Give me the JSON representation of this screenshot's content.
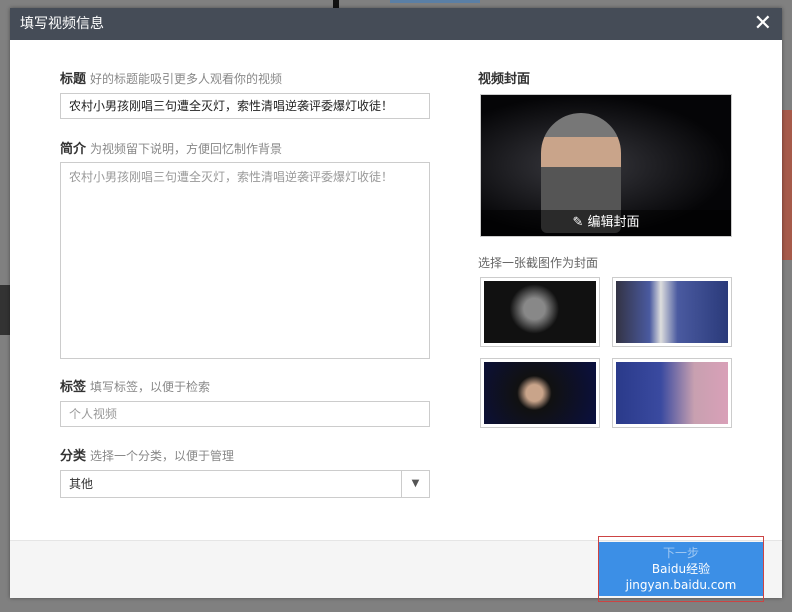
{
  "dialog": {
    "title": "填写视频信息"
  },
  "title_field": {
    "label": "标题",
    "hint": "好的标题能吸引更多人观看你的视频",
    "value": "农村小男孩刚唱三句遭全灭灯，索性清唱逆袭评委爆灯收徒！"
  },
  "intro_field": {
    "label": "简介",
    "hint": "为视频留下说明，方便回忆制作背景",
    "value": "农村小男孩刚唱三句遭全灭灯，索性清唱逆袭评委爆灯收徒！"
  },
  "tags_field": {
    "label": "标签",
    "hint": "填写标签，以便于检索",
    "placeholder": "个人视频"
  },
  "category_field": {
    "label": "分类",
    "hint": "选择一个分类，以便于管理",
    "value": "其他"
  },
  "cover": {
    "label": "视频封面",
    "edit_label": "编辑封面",
    "choose_label": "选择一张截图作为封面"
  },
  "footer": {
    "next_label": "下一步",
    "watermark": "Baidu经验 jingyan.baidu.com"
  }
}
